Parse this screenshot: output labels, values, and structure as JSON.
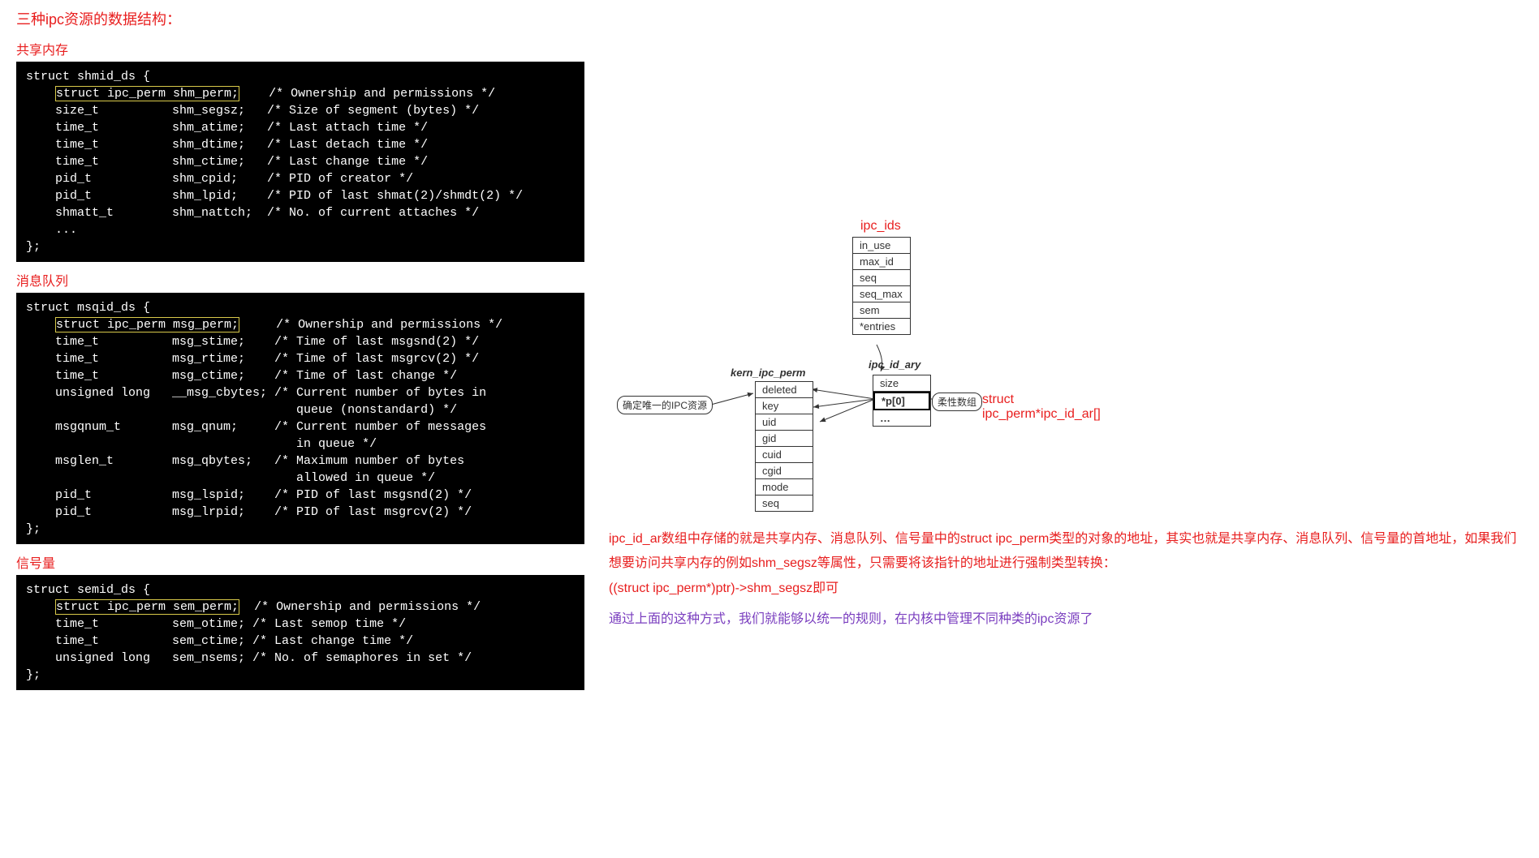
{
  "title": "三种ipc资源的数据结构：",
  "sections": {
    "shm": {
      "label": "共享内存",
      "code": "struct shmid_ds {\n    struct ipc_perm shm_perm;    /* Ownership and permissions */\n    size_t          shm_segsz;   /* Size of segment (bytes) */\n    time_t          shm_atime;   /* Last attach time */\n    time_t          shm_dtime;   /* Last detach time */\n    time_t          shm_ctime;   /* Last change time */\n    pid_t           shm_cpid;    /* PID of creator */\n    pid_t           shm_lpid;    /* PID of last shmat(2)/shmdt(2) */\n    shmatt_t        shm_nattch;  /* No. of current attaches */\n    ...\n};"
    },
    "msg": {
      "label": "消息队列",
      "code": "struct msqid_ds {\n    struct ipc_perm msg_perm;     /* Ownership and permissions */\n    time_t          msg_stime;    /* Time of last msgsnd(2) */\n    time_t          msg_rtime;    /* Time of last msgrcv(2) */\n    time_t          msg_ctime;    /* Time of last change */\n    unsigned long   __msg_cbytes; /* Current number of bytes in\n                                     queue (nonstandard) */\n    msgqnum_t       msg_qnum;     /* Current number of messages\n                                     in queue */\n    msglen_t        msg_qbytes;   /* Maximum number of bytes\n                                     allowed in queue */\n    pid_t           msg_lspid;    /* PID of last msgsnd(2) */\n    pid_t           msg_lrpid;    /* PID of last msgrcv(2) */\n};"
    },
    "sem": {
      "label": "信号量",
      "code": "struct semid_ds {\n    struct ipc_perm sem_perm;  /* Ownership and permissions */\n    time_t          sem_otime; /* Last semop time */\n    time_t          sem_ctime; /* Last change time */\n    unsigned long   sem_nsems; /* No. of semaphores in set */\n};"
    }
  },
  "diagram": {
    "ipc_ids_title": "ipc_ids",
    "ipc_ids_fields": [
      "in_use",
      "max_id",
      "seq",
      "seq_max",
      "sem",
      "*entries"
    ],
    "ipc_id_ary_label": "ipc_id_ary",
    "ipc_id_ary_fields": [
      "size",
      "*p[0]",
      "…"
    ],
    "kern_label": "kern_ipc_perm",
    "kern_fields": [
      "deleted",
      "key",
      "uid",
      "gid",
      "cuid",
      "cgid",
      "mode",
      "seq"
    ],
    "anno_unique": "确定唯一的IPC资源",
    "anno_flex": "柔性数组",
    "struct_label": "struct ipc_perm*ipc_id_ar[]"
  },
  "explanation": {
    "p1": "ipc_id_ar数组中存储的就是共享内存、消息队列、信号量中的struct ipc_perm类型的对象的地址，其实也就是共享内存、消息队列、信号量的首地址，如果我们想要访问共享内存的例如shm_segsz等属性，只需要将该指针的地址进行强制类型转换：",
    "p2": "((struct ipc_perm*)ptr)->shm_segsz即可",
    "p3": "通过上面的这种方式，我们就能够以统一的规则，在内核中管理不同种类的ipc资源了"
  }
}
